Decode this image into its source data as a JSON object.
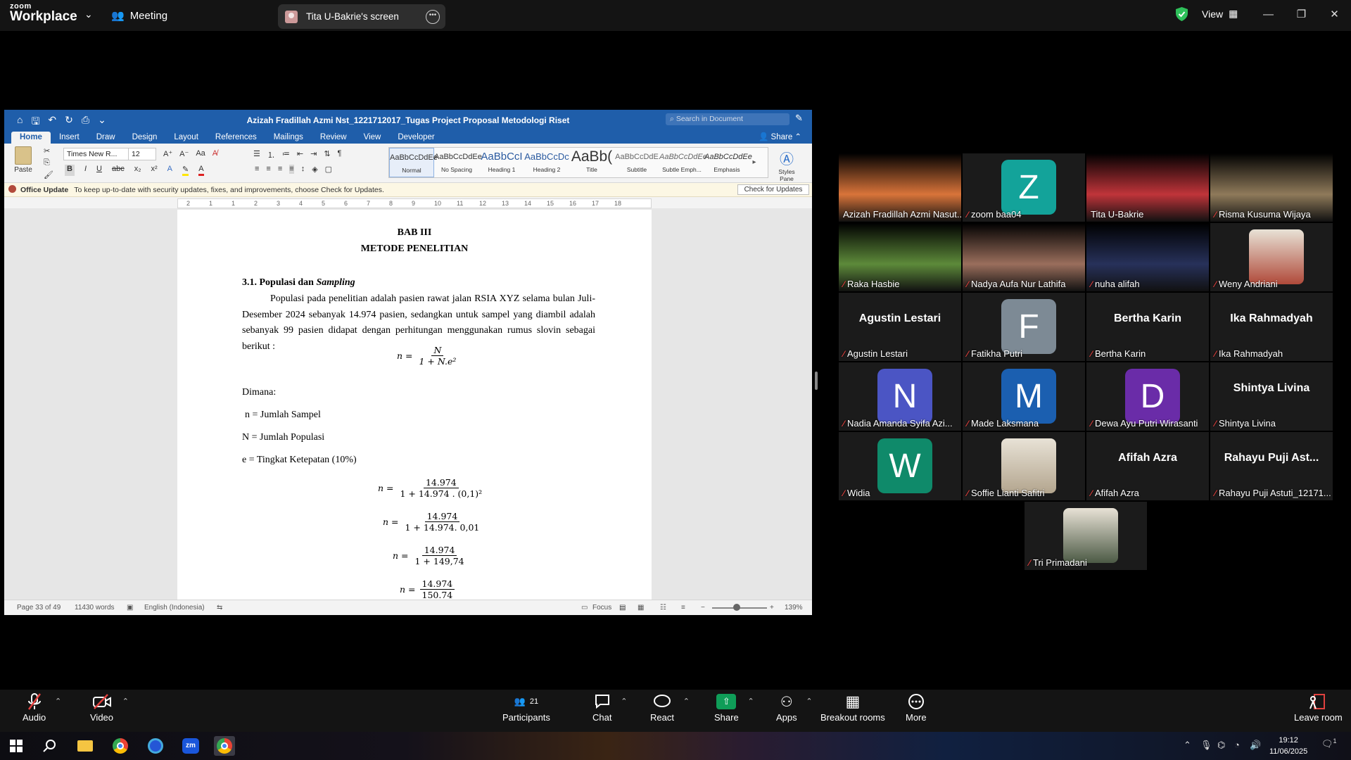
{
  "zoom": {
    "logo_line1": "zoom",
    "logo_line2": "Workplace",
    "meeting_label": "Meeting",
    "screen_share_label": "Tita U-Bakrie's screen",
    "view_label": "View"
  },
  "word": {
    "doc_title": "Azizah Fradillah Azmi Nst_1221712017_Tugas Project Proposal Metodologi Riset",
    "search_placeholder": "Search in Document",
    "tabs": [
      "Home",
      "Insert",
      "Draw",
      "Design",
      "Layout",
      "References",
      "Mailings",
      "Review",
      "View",
      "Developer"
    ],
    "share_label": "Share",
    "paste_label": "Paste",
    "font_name": "Times New R...",
    "font_size": "12",
    "styles": [
      {
        "preview": "AaBbCcDdEe",
        "name": "Normal"
      },
      {
        "preview": "AaBbCcDdEe",
        "name": "No Spacing"
      },
      {
        "preview": "AaBbCcI",
        "name": "Heading 1"
      },
      {
        "preview": "AaBbCcDc",
        "name": "Heading 2"
      },
      {
        "preview": "AaBb(",
        "name": "Title"
      },
      {
        "preview": "AaBbCcDdE",
        "name": "Subtitle"
      },
      {
        "preview": "AaBbCcDdEe",
        "name": "Subtle Emph..."
      },
      {
        "preview": "AaBbCcDdEe",
        "name": "Emphasis"
      }
    ],
    "styles_pane_label": "Styles Pane",
    "update_title": "Office Update",
    "update_text": "To keep up-to-date with security updates, fixes, and improvements, choose Check for Updates.",
    "update_button": "Check for Updates",
    "ruler_marks": [
      "2",
      "1",
      "1",
      "2",
      "3",
      "4",
      "5",
      "6",
      "7",
      "8",
      "9",
      "10",
      "11",
      "12",
      "13",
      "14",
      "15",
      "16",
      "17",
      "18"
    ],
    "status": {
      "page": "Page 33 of 49",
      "words": "11430 words",
      "language": "English (Indonesia)",
      "focus": "Focus",
      "zoom": "139%"
    }
  },
  "document": {
    "chapter": "BAB III",
    "chapter_title": "METODE PENELITIAN",
    "section_prefix": "3.1. Populasi dan ",
    "section_italic": "Sampling",
    "paragraph": "Populasi pada penelitian adalah pasien rawat jalan RSIA XYZ selama bulan Juli-Desember 2024 sebanyak 14.974 pasien, sedangkan untuk sampel yang diambil adalah sebanyak 99 pasien didapat dengan perhitungan menggunakan rumus slovin sebagai berikut :",
    "formula": {
      "lhs": "n =",
      "num": "N",
      "den": "1 + N.e²"
    },
    "dimana": "Dimana:",
    "def_n": "n = Jumlah Sampel",
    "def_N": "N = Jumlah Populasi",
    "def_e": "e = Tingkat Ketepatan (10%)",
    "calc": [
      {
        "lhs": "n =",
        "num": "14.974",
        "den": "1 + 14.974 . (0,1)²"
      },
      {
        "lhs": "n =",
        "num": "14.974",
        "den": "1 + 14.974. 0,01"
      },
      {
        "lhs": "n =",
        "num": "14.974",
        "den": "1 + 149,74"
      },
      {
        "lhs": "n =",
        "num": "14.974",
        "den": "150.74"
      }
    ]
  },
  "participants": [
    {
      "name": "Azizah Fradillah Azmi Nasut...",
      "muted": false,
      "kind": "video",
      "bg": "#d9743a"
    },
    {
      "name": "zoom baa04",
      "muted": true,
      "kind": "letter",
      "letter": "Z",
      "color": "#13a39a"
    },
    {
      "name": "Tita U-Bakrie",
      "muted": false,
      "kind": "video",
      "bg": "#c0343a",
      "active": true
    },
    {
      "name": "Risma Kusuma Wijaya",
      "muted": true,
      "kind": "video",
      "bg": "#8f7a5a"
    },
    {
      "name": "Raka Hasbie",
      "muted": true,
      "kind": "video",
      "bg": "#5d8a3a"
    },
    {
      "name": "Nadya Aufa Nur Lathifa",
      "muted": true,
      "kind": "video",
      "bg": "#9a6e5c"
    },
    {
      "name": "nuha alifah",
      "muted": true,
      "kind": "video",
      "bg": "#27315a"
    },
    {
      "name": "Weny Andriani",
      "muted": true,
      "kind": "photo",
      "bg": "#b04a3a"
    },
    {
      "name": "Agustin Lestari",
      "muted": true,
      "kind": "text",
      "display": "Agustin Lestari"
    },
    {
      "name": "Fatikha Putri",
      "muted": true,
      "kind": "letter",
      "letter": "F",
      "color": "#7d8a95"
    },
    {
      "name": "Bertha Karin",
      "muted": true,
      "kind": "text",
      "display": "Bertha Karin"
    },
    {
      "name": "Ika Rahmadyah",
      "muted": true,
      "kind": "text",
      "display": "Ika Rahmadyah"
    },
    {
      "name": "Nadia Amanda Syifa Azi...",
      "muted": true,
      "kind": "letter",
      "letter": "N",
      "color": "#4b55c4"
    },
    {
      "name": "Made Laksmana",
      "muted": true,
      "kind": "letter",
      "letter": "M",
      "color": "#1b5fb0"
    },
    {
      "name": "Dewa Ayu Putri Wirasanti",
      "muted": true,
      "kind": "letter",
      "letter": "D",
      "color": "#6a2ca8"
    },
    {
      "name": "Shintya Livina",
      "muted": true,
      "kind": "text",
      "display": "Shintya Livina"
    },
    {
      "name": "Widia",
      "muted": true,
      "kind": "letter",
      "letter": "W",
      "color": "#0f8a6a"
    },
    {
      "name": "Soffie Lianti Safitri",
      "muted": true,
      "kind": "photo",
      "bg": "#b3a58e"
    },
    {
      "name": "Afifah Azra",
      "muted": true,
      "kind": "text",
      "display": "Afifah Azra"
    },
    {
      "name": "Rahayu Puji Astuti_12171...",
      "muted": true,
      "kind": "text",
      "display": "Rahayu Puji Ast..."
    },
    {
      "name": "Tri Primadani",
      "muted": true,
      "kind": "photo",
      "bg": "#4c5a45"
    }
  ],
  "toolbar": {
    "audio": "Audio",
    "video": "Video",
    "participants": "Participants",
    "participants_count": "21",
    "chat": "Chat",
    "react": "React",
    "share": "Share",
    "apps": "Apps",
    "breakout": "Breakout rooms",
    "more": "More",
    "leave": "Leave room"
  },
  "taskbar": {
    "time": "19:12",
    "date": "11/06/2025",
    "notif_count": "1"
  },
  "colors": {
    "word_blue": "#1f5eaa",
    "active_speaker": "#23d160",
    "muted_red": "#e0413e",
    "share_green": "#0f9d58"
  }
}
